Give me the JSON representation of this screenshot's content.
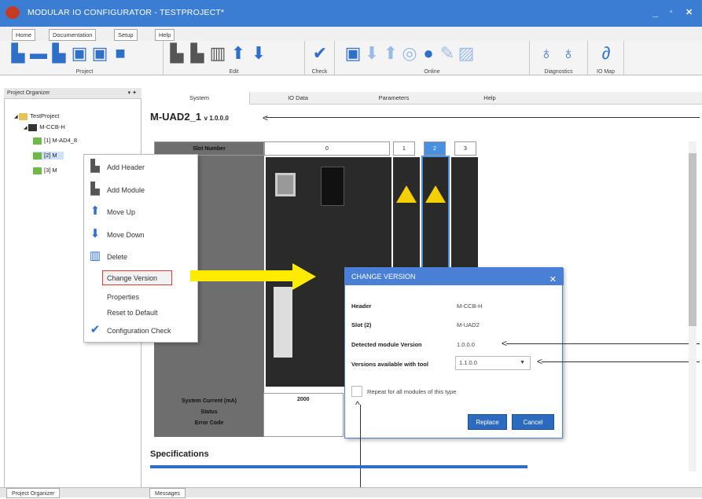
{
  "app": {
    "title": "MODULAR IO CONFIGURATOR - TESTPROJECT*"
  },
  "window_controls": {
    "minimize": "_",
    "maximize": "▫",
    "close": "✕"
  },
  "menu": {
    "tabs": [
      "Home",
      "Documentation",
      "Setup",
      "Help"
    ]
  },
  "ribbon": {
    "groups": [
      {
        "label": "Project"
      },
      {
        "label": "Edit"
      },
      {
        "label": "Check"
      },
      {
        "label": "Online"
      },
      {
        "label": "Diagnostics"
      },
      {
        "label": "IO Map"
      }
    ]
  },
  "sidebar": {
    "header": "Project Organizer",
    "pin": "▾ ✦",
    "tree": [
      {
        "label": "TestProject"
      },
      {
        "label": "M-CCB-H"
      },
      {
        "label": "[1] M-AD4_8"
      },
      {
        "label": "[2] M"
      },
      {
        "label": "[3] M"
      }
    ]
  },
  "context_menu": {
    "items": [
      {
        "label": "Add Header",
        "icon": "add-header-icon"
      },
      {
        "label": "Add Module",
        "icon": "add-module-icon"
      },
      {
        "label": "Move Up",
        "icon": "arrow-up-icon"
      },
      {
        "label": "Move Down",
        "icon": "arrow-down-icon"
      },
      {
        "label": "Delete",
        "icon": "trash-icon"
      },
      {
        "label": "Change Version",
        "icon": ""
      },
      {
        "label": "Properties",
        "icon": ""
      },
      {
        "label": "Reset to Default",
        "icon": ""
      },
      {
        "label": "Configuration Check",
        "icon": "check-icon"
      }
    ],
    "highlighted": "Change Version"
  },
  "main": {
    "tabs": [
      "System",
      "IO Data",
      "Parameters",
      "Help"
    ],
    "active_tab": "System",
    "module_name": "M-UAD2_1",
    "module_version": "v 1.0.0.0",
    "slot_header_label": "Slot Number",
    "slot_numbers": [
      "0",
      "1",
      "2",
      "3"
    ],
    "row_labels": [
      "System Current (mA)",
      "Status",
      "Error Code"
    ],
    "system_current_value": "2000",
    "specifications_title": "Specifications"
  },
  "dialog": {
    "title": "CHANGE VERSION",
    "close": "✕",
    "fields": [
      {
        "key": "Header",
        "value": "M-CCB-H"
      },
      {
        "key": "Slot (2)",
        "value": "M-UAD2"
      },
      {
        "key": "Detected module Version",
        "value": "1.0.0.0"
      }
    ],
    "select_label": "Versions available with tool",
    "select_value": "1.1.0.0",
    "checkbox_label": "Repeat for all modules of this type",
    "replace_button": "Replace",
    "cancel_button": "Cancel"
  },
  "bottom": {
    "tabs": [
      "Project Organizer",
      "Messages"
    ]
  },
  "colors": {
    "titlebar": "#3c7dd4",
    "accent": "#2e6fc9",
    "highlight_arrow": "#ffeb00",
    "highlight_border": "#e53935"
  }
}
